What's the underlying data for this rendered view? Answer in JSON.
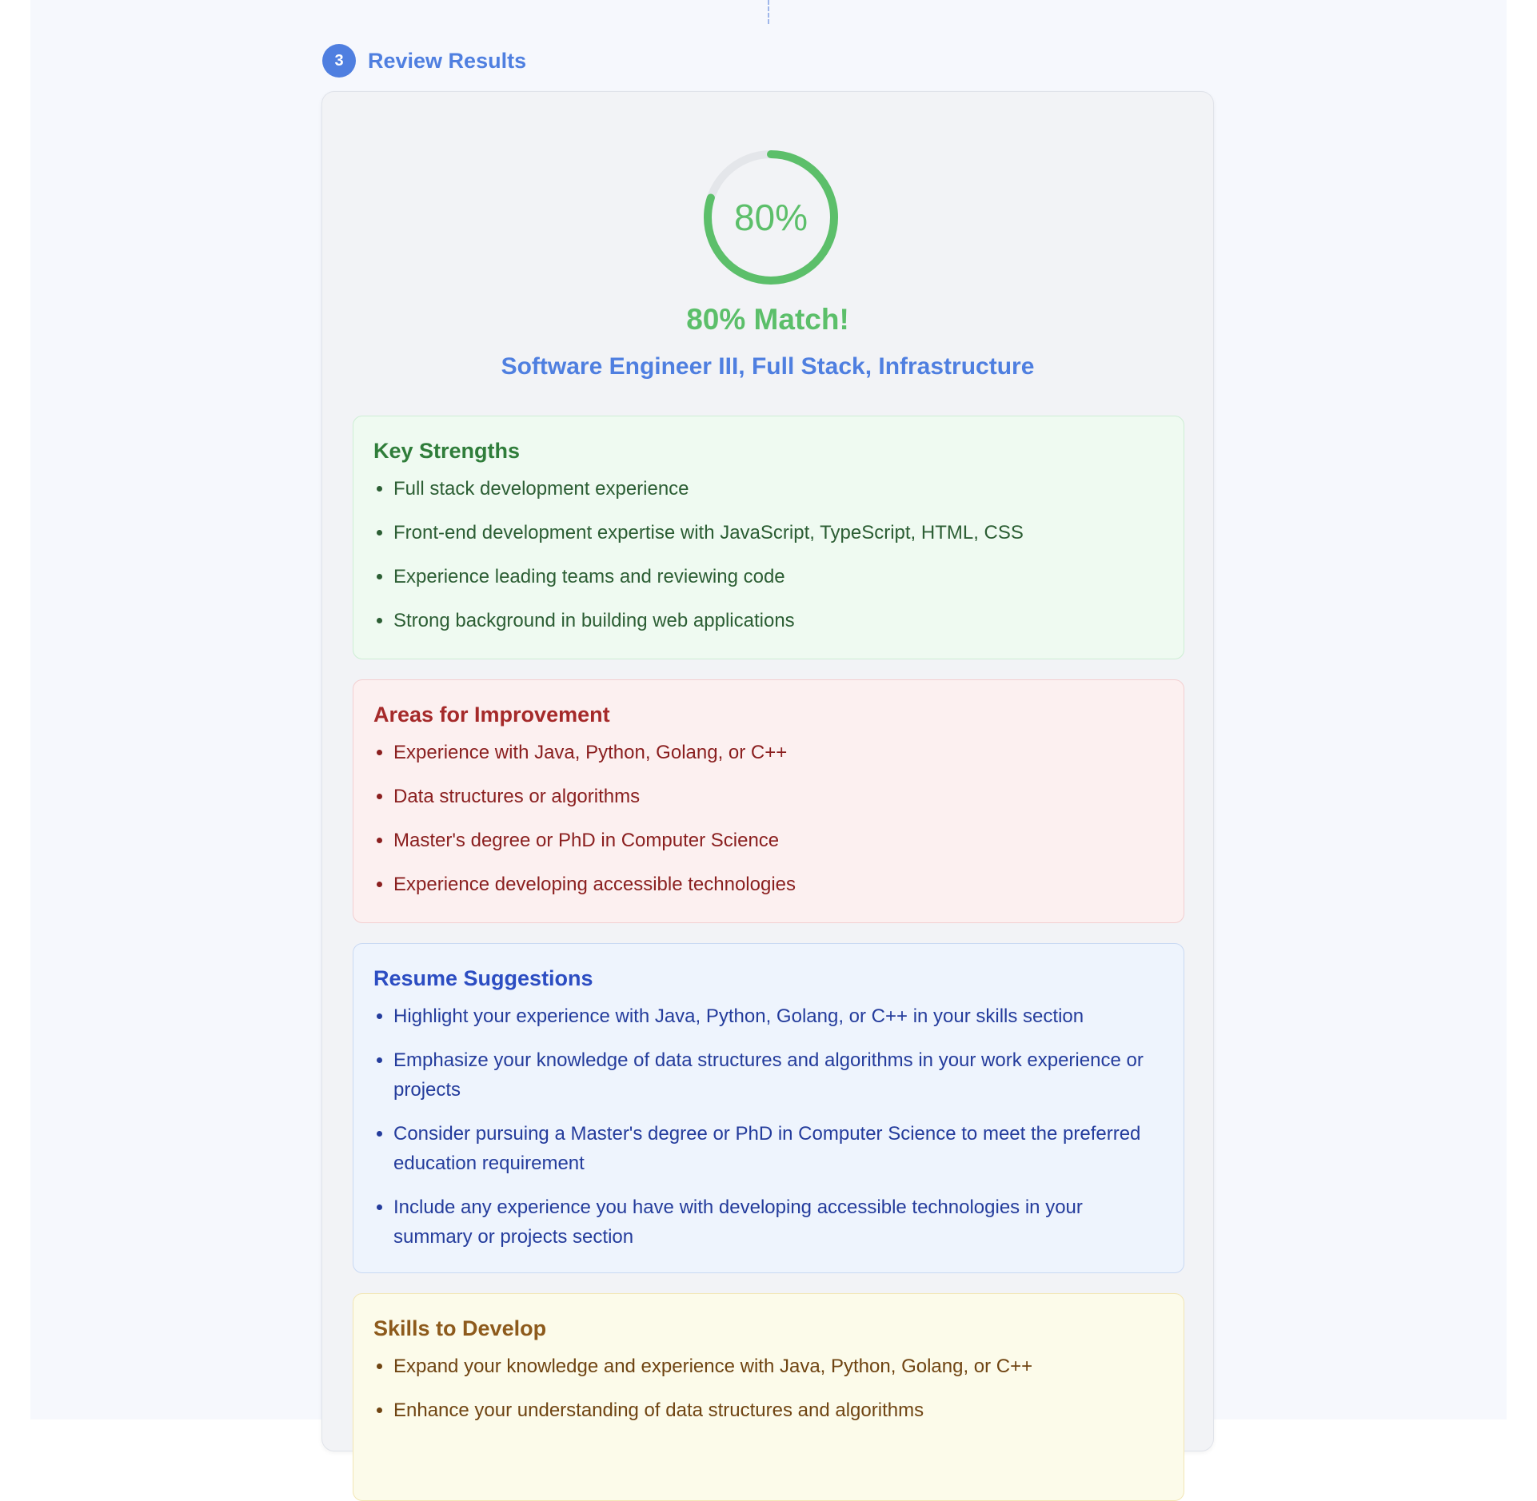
{
  "step": {
    "number": "3",
    "title": "Review Results"
  },
  "score": {
    "percent_text": "80%",
    "fraction": 0.8,
    "color": "#5cbf6a",
    "track_color": "#e4e6ea"
  },
  "match": {
    "heading": "80% Match!",
    "job_title": "Software Engineer III, Full Stack, Infrastructure"
  },
  "sections": {
    "strengths": {
      "title": "Key Strengths",
      "items": [
        "Full stack development experience",
        "Front-end development expertise with JavaScript, TypeScript, HTML, CSS",
        "Experience leading teams and reviewing code",
        "Strong background in building web applications"
      ]
    },
    "improvement": {
      "title": "Areas for Improvement",
      "items": [
        "Experience with Java, Python, Golang, or C++",
        "Data structures or algorithms",
        "Master's degree or PhD in Computer Science",
        "Experience developing accessible technologies"
      ]
    },
    "suggestions": {
      "title": "Resume Suggestions",
      "items": [
        "Highlight your experience with Java, Python, Golang, or C++ in your skills section",
        "Emphasize your knowledge of data structures and algorithms in your work experience or projects",
        "Consider pursuing a Master's degree or PhD in Computer Science to meet the preferred education requirement",
        "Include any experience you have with developing accessible technologies in your summary or projects section"
      ]
    },
    "skills": {
      "title": "Skills to Develop",
      "items": [
        "Expand your knowledge and experience with Java, Python, Golang, or C++",
        "Enhance your understanding of data structures and algorithms"
      ]
    }
  }
}
